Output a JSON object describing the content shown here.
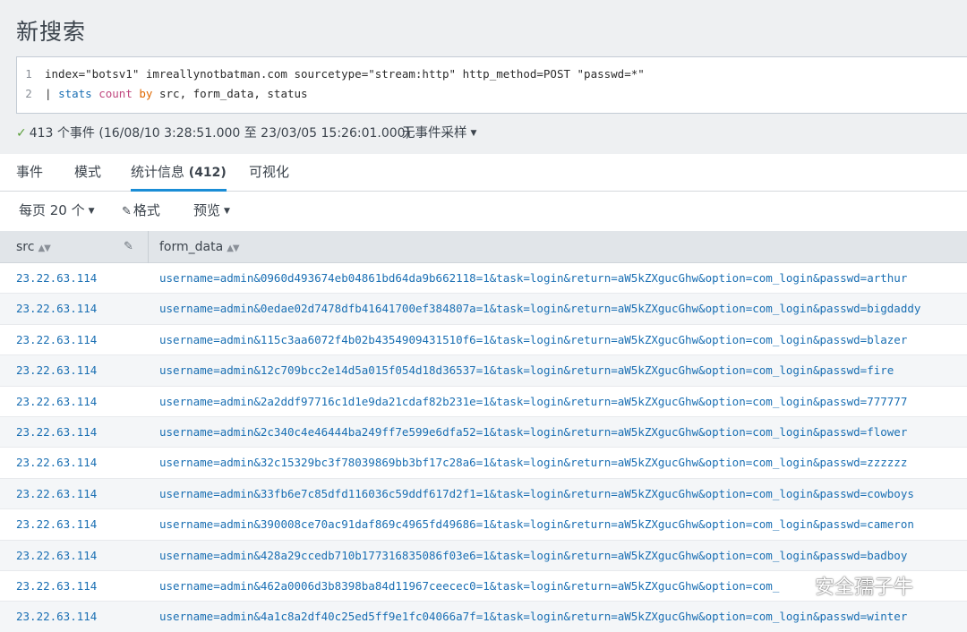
{
  "page": {
    "title": "新搜索"
  },
  "search": {
    "line_numbers": [
      "1",
      "2"
    ],
    "line1": "index=\"botsv1\" imreallynotbatman.com sourcetype=\"stream:http\" http_method=POST \"passwd=*\"",
    "line2_pipe": "|",
    "line2_command": "stats",
    "line2_function": "count",
    "line2_keyword": "by",
    "line2_args": "src, form_data, status"
  },
  "status": {
    "events_text": "413 个事件 (16/08/10 3:28:51.000 至 23/03/05 15:26:01.000)",
    "sampling_label": "无事件采样"
  },
  "tabs": [
    {
      "label": "事件"
    },
    {
      "label": "模式"
    },
    {
      "label": "统计信息",
      "count": "(412)"
    },
    {
      "label": "可视化"
    }
  ],
  "toolbar": {
    "per_page": "每页 20 个",
    "format": "格式",
    "preview": "预览"
  },
  "table": {
    "columns": [
      "src",
      "form_data"
    ],
    "rows": [
      {
        "src": "23.22.63.114",
        "form_data": "username=admin&0960d493674eb04861bd64da9b662118=1&task=login&return=aW5kZXgucGhw&option=com_login&passwd=arthur"
      },
      {
        "src": "23.22.63.114",
        "form_data": "username=admin&0edae02d7478dfb41641700ef384807a=1&task=login&return=aW5kZXgucGhw&option=com_login&passwd=bigdaddy"
      },
      {
        "src": "23.22.63.114",
        "form_data": "username=admin&115c3aa6072f4b02b4354909431510f6=1&task=login&return=aW5kZXgucGhw&option=com_login&passwd=blazer"
      },
      {
        "src": "23.22.63.114",
        "form_data": "username=admin&12c709bcc2e14d5a015f054d18d36537=1&task=login&return=aW5kZXgucGhw&option=com_login&passwd=fire"
      },
      {
        "src": "23.22.63.114",
        "form_data": "username=admin&2a2ddf97716c1d1e9da21cdaf82b231e=1&task=login&return=aW5kZXgucGhw&option=com_login&passwd=777777"
      },
      {
        "src": "23.22.63.114",
        "form_data": "username=admin&2c340c4e46444ba249ff7e599e6dfa52=1&task=login&return=aW5kZXgucGhw&option=com_login&passwd=flower"
      },
      {
        "src": "23.22.63.114",
        "form_data": "username=admin&32c15329bc3f78039869bb3bf17c28a6=1&task=login&return=aW5kZXgucGhw&option=com_login&passwd=zzzzzz"
      },
      {
        "src": "23.22.63.114",
        "form_data": "username=admin&33fb6e7c85dfd116036c59ddf617d2f1=1&task=login&return=aW5kZXgucGhw&option=com_login&passwd=cowboys"
      },
      {
        "src": "23.22.63.114",
        "form_data": "username=admin&390008ce70ac91daf869c4965fd49686=1&task=login&return=aW5kZXgucGhw&option=com_login&passwd=cameron"
      },
      {
        "src": "23.22.63.114",
        "form_data": "username=admin&428a29ccedb710b177316835086f03e6=1&task=login&return=aW5kZXgucGhw&option=com_login&passwd=badboy"
      },
      {
        "src": "23.22.63.114",
        "form_data": "username=admin&462a0006d3b8398ba84d11967ceecec0=1&task=login&return=aW5kZXgucGhw&option=com_"
      },
      {
        "src": "23.22.63.114",
        "form_data": "username=admin&4a1c8a2df40c25ed5ff9e1fc04066a7f=1&task=login&return=aW5kZXgucGhw&option=com_login&passwd=winter"
      }
    ]
  },
  "watermark": {
    "text": "安全孺子牛"
  },
  "icons": {
    "check": "check-icon",
    "caret": "caret-down-icon",
    "pencil": "pencil-icon",
    "sort": "sort-icon",
    "wechat": "wechat-icon"
  },
  "colors": {
    "link": "#1a6fb3",
    "tab_active": "#1a8dd6",
    "check": "#5a9e3a",
    "spl_command": "#1a6fb3",
    "spl_function": "#c0477e",
    "spl_keyword": "#e06800"
  }
}
